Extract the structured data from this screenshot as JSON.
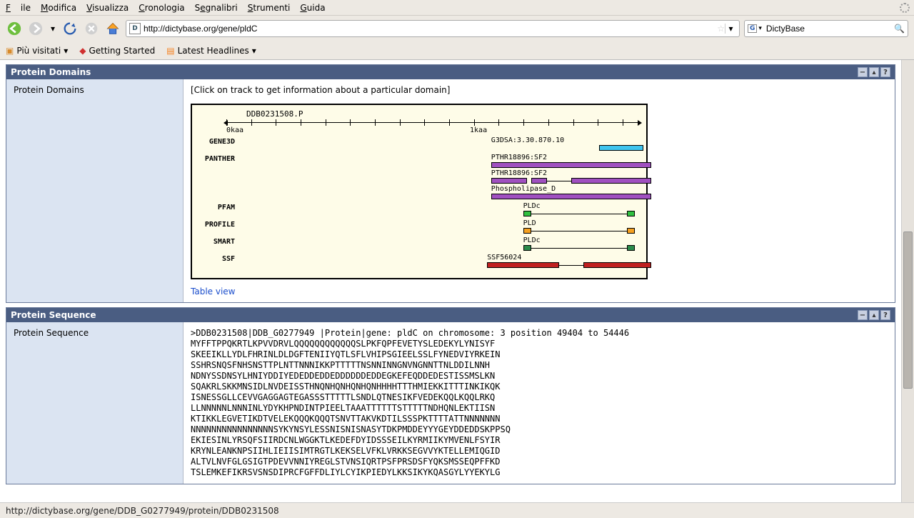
{
  "menu": {
    "file": "File",
    "edit": "Modifica",
    "view": "Visualizza",
    "history": "Cronologia",
    "bookmarks": "Segnalibri",
    "tools": "Strumenti",
    "help": "Guida"
  },
  "url": "http://dictybase.org/gene/pldC",
  "search_engine_letter": "G",
  "search_value": "DictyBase",
  "bookmarks_bar": {
    "most": "Più visitati",
    "started": "Getting Started",
    "latest": "Latest Headlines"
  },
  "panels": {
    "domains": {
      "title": "Protein Domains",
      "side": "Protein Domains",
      "hint": "[Click on track to get information about a particular domain]",
      "table_link": "Table view",
      "axis": {
        "protein_label": "DDB0231508.P",
        "start": "0kaa",
        "mid": "1kaa"
      },
      "tracks": {
        "gene3d": "GENE3D",
        "panther": "PANTHER",
        "pfam": "PFAM",
        "profile": "PROFILE",
        "smart": "SMART",
        "ssf": "SSF"
      },
      "labels": {
        "g3d": "G3DSA:3.30.870.10",
        "pthr1": "PTHR18896:SF2",
        "pthr2": "PTHR18896:SF2",
        "phos": "Phospholipase_D",
        "pldc": "PLDc",
        "pld": "PLD",
        "pldc2": "PLDc",
        "ssf": "SSF56024"
      }
    },
    "sequence": {
      "title": "Protein Sequence",
      "side": "Protein Sequence",
      "header": ">DDB0231508|DDB_G0277949 |Protein|gene: pldC on chromosome: 3 position 49404 to 54446",
      "lines": [
        "MYFFTPPQKRTLKPVVDRVLQQQQQQQQQQQQSLPKFQPFEVETYSLEDEKYLYNISYF",
        "SKEEIKLLYDLFHRINLDLDGFTENIIYQTLSFLVHIPSGIEELSSLFYNEDVIYRKEIN",
        "SSHRSNQSFNHSNSTTPLNTTNNNIKKPTTTTTNSNNINNGNVNGNNTTNLDDILNNH",
        "NDNYSSDNSYLHNIYDDIYEDEDDEDDEDDDDDDEDDEGKEFEQDDEDESTISSMSLKN",
        "SQAKRLSKKMNSIDLNVDEISSTHNQNHQNHQNHQNHHHHTTTHMIEKKITTTINKIKQK",
        "ISNESSGLLCEVVGAGGAGTEGASSSTTTTTLSNDLQTNESIKFVEDEKQQLKQQLRKQ",
        "LLNNNNNLNNNINLYDYKHPNDINTPIEELTAAATTTTTTSTTTTTNDHQNLEKTIISN",
        "KTIKKLEGVETIKDTVELEKQQQKQQQTSNVTTAKVKDTILSSSPKTTTTATTNNNNNNN",
        "NNNNNNNNNNNNNNNNSYKYNSYLESSNISNISNASYTDKPMDDEYYYGEYDDEDDSKPPSQ",
        "EKIESINLYRSQFSIIRDCNLWGGKTLKEDEFDYIDSSSEILKYRMIIKYMVENLFSYIR",
        "KRYNLEANKNPSIIHLIEIISIMTRGTLKEKSELVFKLVRKKSEGVVYKTELLEMIQGID",
        "ALTVLNVFGLGSIGTPDEVVNNIYREGLSTVNSIQRTPSFPRSDSFYQKSMSSEQPFFKD",
        "TSLEMKEFIKRSVSNSDIPRCFGFFDLIYLCYIKPIEDYLKKSIKYKQASGYLYYEKYLG"
      ]
    }
  },
  "status": "http://dictybase.org/gene/DDB_G0277949/protein/DDB0231508"
}
